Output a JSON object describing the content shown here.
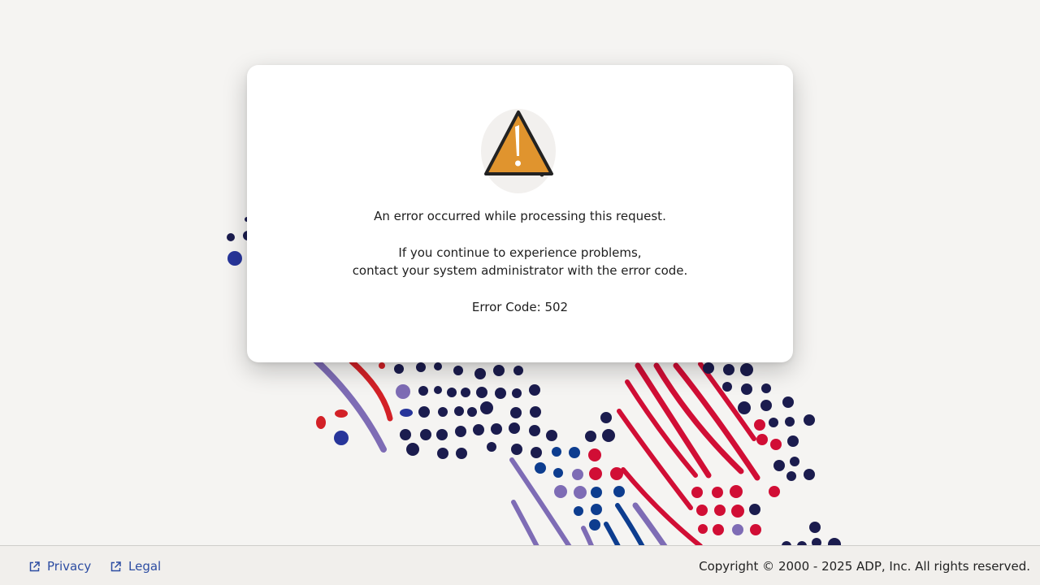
{
  "error_card": {
    "icon": "warning-triangle-icon",
    "message": "An error occurred while processing this request.",
    "hint_line1": "If you continue to experience problems,",
    "hint_line2": "contact your system administrator with the error code.",
    "error_code_text": "Error Code: 502"
  },
  "footer": {
    "links": [
      {
        "label": "Privacy",
        "icon": "external-link-icon"
      },
      {
        "label": "Legal",
        "icon": "external-link-icon"
      }
    ],
    "copyright": "Copyright © 2000 - 2025 ADP, Inc. All rights reserved."
  },
  "colors": {
    "background": "#f5f4f2",
    "card": "#ffffff",
    "warning_orange": "#e0942e",
    "link_blue": "#2d4da2",
    "art_navy": "#1b1c4e",
    "art_red": "#d10e35",
    "art_purple": "#7e6cb5",
    "art_blue": "#0d3d8f"
  }
}
